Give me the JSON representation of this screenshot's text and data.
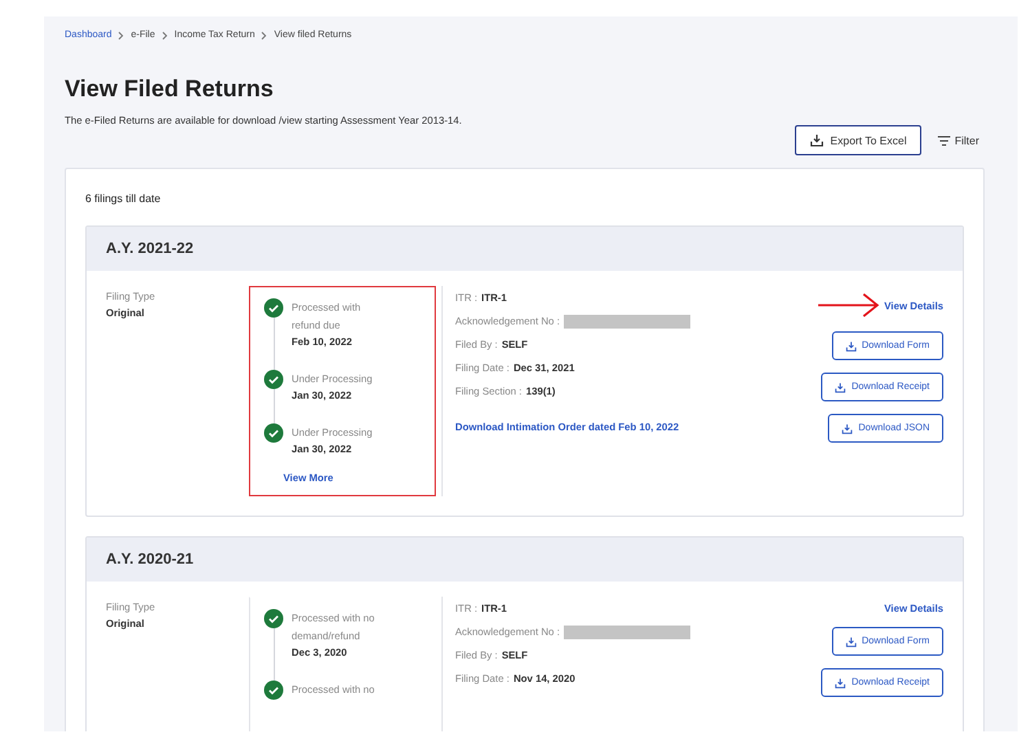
{
  "breadcrumb": [
    {
      "label": "Dashboard",
      "link": true
    },
    {
      "label": "e-File",
      "link": false
    },
    {
      "label": "Income Tax Return",
      "link": false
    },
    {
      "label": "View filed Returns",
      "link": false
    }
  ],
  "title": "View Filed Returns",
  "subtitle": "The e-Filed Returns are available for download /view starting Assessment Year 2013-14.",
  "export_button": "Export To Excel",
  "filter_button": "Filter",
  "count": "6 filings till date",
  "filings": [
    {
      "ay": "A.Y. 2021-22",
      "filing_type_label": "Filing Type",
      "filing_type": "Original",
      "highlighted": true,
      "timeline": [
        {
          "status": "Processed with refund due",
          "date": "Feb 10, 2022"
        },
        {
          "status": "Under Processing",
          "date": "Jan 30, 2022"
        },
        {
          "status": "Under Processing",
          "date": "Jan 30, 2022"
        }
      ],
      "view_more": "View More",
      "details": [
        {
          "label": "ITR :",
          "value": "ITR-1",
          "kind": "text"
        },
        {
          "label": "Acknowledgement No :",
          "kind": "redacted"
        },
        {
          "label": "Filed By :",
          "value": "SELF",
          "kind": "text"
        },
        {
          "label": "Filing Date :",
          "value": "Dec 31, 2021",
          "kind": "text"
        },
        {
          "label": "Filing Section :",
          "value": "139(1)",
          "kind": "text"
        }
      ],
      "intimation_link": "Download Intimation Order dated Feb 10, 2022",
      "arrow": true,
      "view_details": "View Details",
      "buttons": [
        "Download Form",
        "Download Receipt",
        "Download JSON"
      ]
    },
    {
      "ay": "A.Y. 2020-21",
      "filing_type_label": "Filing Type",
      "filing_type": "Original",
      "highlighted": false,
      "timeline": [
        {
          "status": "Processed with no demand/refund",
          "date": "Dec 3, 2020"
        },
        {
          "status": "Processed with no"
        }
      ],
      "details": [
        {
          "label": "ITR :",
          "value": "ITR-1",
          "kind": "text"
        },
        {
          "label": "Acknowledgement No :",
          "kind": "redacted"
        },
        {
          "label": "Filed By :",
          "value": "SELF",
          "kind": "text"
        },
        {
          "label": "Filing Date :",
          "value": "Nov 14, 2020",
          "kind": "text"
        }
      ],
      "arrow": false,
      "view_details": "View Details",
      "buttons": [
        "Download Form",
        "Download Receipt"
      ]
    }
  ]
}
